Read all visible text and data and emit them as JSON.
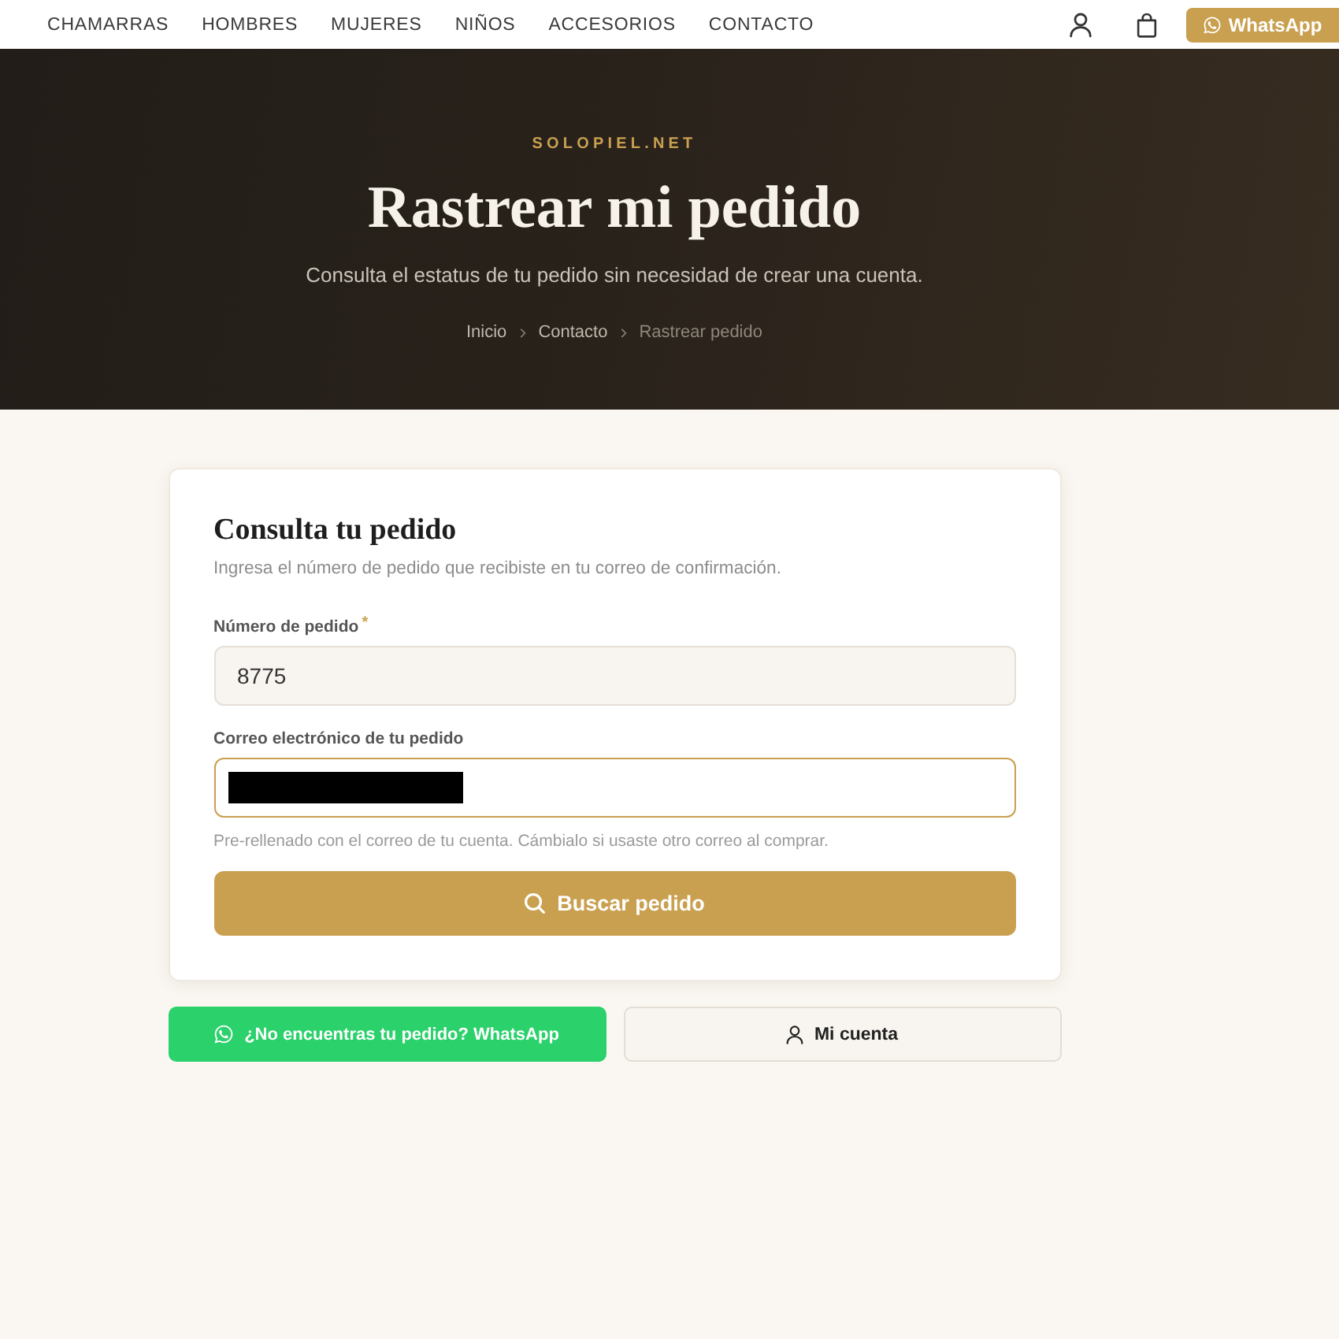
{
  "header": {
    "nav": [
      "CHAMARRAS",
      "HOMBRES",
      "MUJERES",
      "NIÑOS",
      "ACCESORIOS",
      "CONTACTO"
    ],
    "whatsapp_button": "WhatsApp"
  },
  "hero": {
    "eyebrow": "SOLOPIEL.NET",
    "title": "Rastrear mi pedido",
    "subtitle": "Consulta el estatus de tu pedido sin necesidad de crear una cuenta.",
    "breadcrumb": [
      {
        "label": "Inicio",
        "current": false
      },
      {
        "label": "Contacto",
        "current": false
      },
      {
        "label": "Rastrear pedido",
        "current": true
      }
    ]
  },
  "form": {
    "title": "Consulta tu pedido",
    "description": "Ingresa el número de pedido que recibiste en tu correo de confirmación.",
    "fields": [
      {
        "label": "Número de pedido",
        "required_mark": "*",
        "value": "8775",
        "focused": false,
        "redacted": false
      },
      {
        "label": "Correo electrónico de tu pedido",
        "focused": true,
        "redacted": true,
        "hint": "Pre-rellenado con el correo de tu cuenta. Cámbialo si usaste otro correo al comprar."
      }
    ],
    "submit": "Buscar pedido"
  },
  "actions": [
    {
      "kind": "whatsapp",
      "label": "¿No encuentras tu pedido? WhatsApp"
    },
    {
      "kind": "account",
      "label": "Mi cuenta"
    }
  ]
}
